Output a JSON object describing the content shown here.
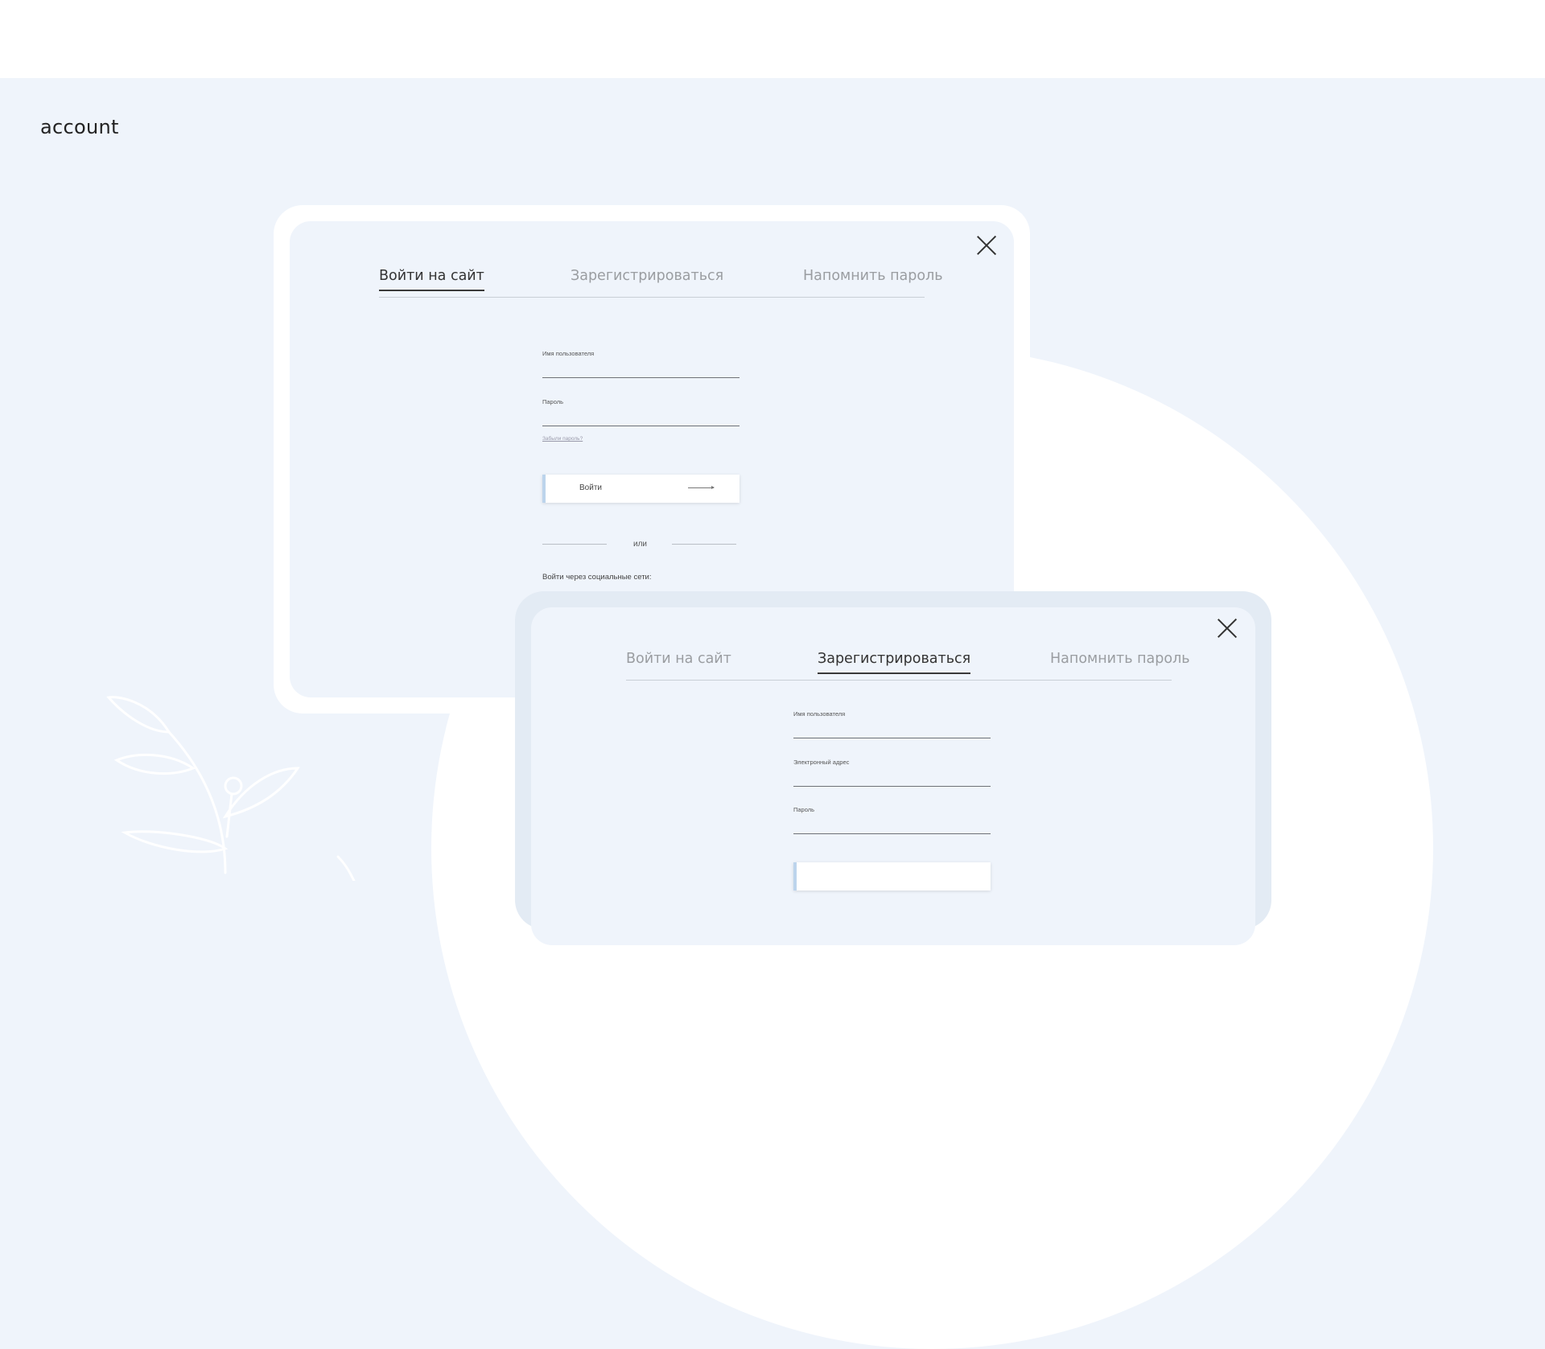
{
  "page": {
    "section_title": "account"
  },
  "login_window": {
    "tabs": [
      {
        "label": "Войти на сайт",
        "active": true
      },
      {
        "label": "Зарегистрироваться",
        "active": false
      },
      {
        "label": "Напомнить пароль",
        "active": false
      }
    ],
    "fields": {
      "username_label": "Имя пользователя",
      "password_label": "Пароль"
    },
    "forgot_password": "Забыли пароль?",
    "submit_label": "Войти",
    "or_text": "или",
    "social_text": "Войти через социальные сети:"
  },
  "register_window": {
    "tabs": [
      {
        "label": "Войти на сайт",
        "active": false
      },
      {
        "label": "Зарегистрироваться",
        "active": true
      },
      {
        "label": "Напомнить пароль",
        "active": false
      }
    ],
    "fields": {
      "username_label": "Имя пользователя",
      "email_label": "Электронный адрес",
      "password_label": "Пароль"
    }
  },
  "colors": {
    "background": "#eff4fb",
    "panel": "#eff4fb",
    "frame_front": "#e3ebf4",
    "accent": "#bcd4ec",
    "text_dark": "#333333",
    "text_muted": "#9a9da1"
  },
  "icons": [
    "close-icon",
    "arrow-right-icon",
    "leaf-decoration-icon"
  ]
}
